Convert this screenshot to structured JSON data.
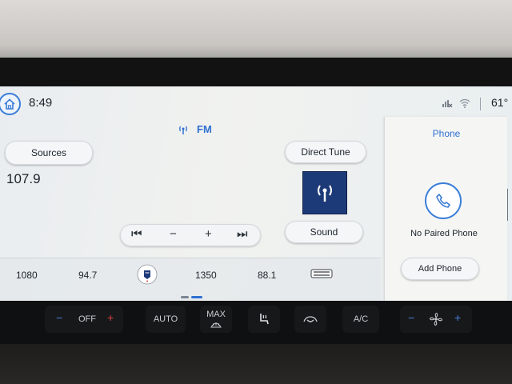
{
  "status_bar": {
    "time": "8:49",
    "outside_temp": "61°"
  },
  "source": {
    "band": "FM",
    "frequency": "107.9"
  },
  "buttons": {
    "sources": "Sources",
    "direct_tune": "Direct Tune",
    "sound": "Sound"
  },
  "tuner": {
    "seek_back": "⏮",
    "minus": "−",
    "plus": "+",
    "seek_forward": "⏭"
  },
  "presets": [
    "1080",
    "94.7",
    "1350",
    "88.1"
  ],
  "phone_panel": {
    "title": "Phone",
    "status": "No Paired Phone",
    "add_button": "Add Phone"
  },
  "climate": {
    "temp_minus": "−",
    "temp_plus": "+",
    "temp_value": "OFF",
    "auto": "AUTO",
    "max_defrost": "MAX",
    "ac": "A/C",
    "fan_minus": "−",
    "fan_plus": "+"
  },
  "colors": {
    "accent": "#2f6fd1",
    "art_bg": "#1d3a78",
    "heat": "#d8413b",
    "cool": "#4a7fe0"
  }
}
